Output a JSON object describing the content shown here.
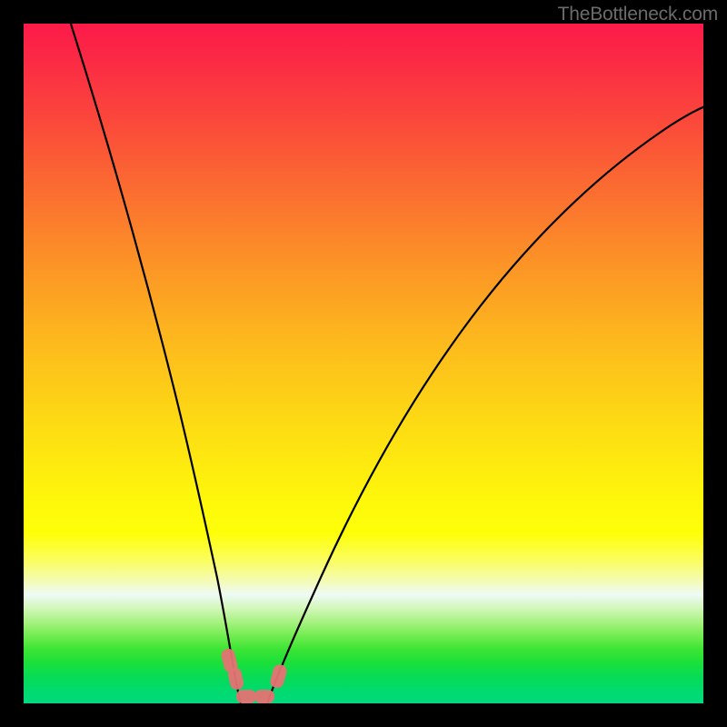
{
  "watermark": "TheBottleneck.com",
  "colors": {
    "gradient_top": "#fc1a49",
    "gradient_mid": "#fdde13",
    "gradient_bottom": "#00d97e",
    "curve": "#000000",
    "blob": "#e57373",
    "frame": "#000000"
  },
  "chart_data": {
    "type": "line",
    "title": "",
    "xlabel": "",
    "ylabel": "",
    "xlim": [
      0,
      100
    ],
    "ylim": [
      0,
      100
    ],
    "grid": false,
    "series": [
      {
        "name": "left-curve",
        "x": [
          7,
          10,
          13,
          16,
          19,
          22,
          25,
          27,
          28.5,
          29.5,
          30
        ],
        "y": [
          100,
          90,
          78,
          65,
          52,
          38,
          24,
          13,
          6,
          2,
          0
        ]
      },
      {
        "name": "right-curve",
        "x": [
          35,
          37,
          40,
          45,
          50,
          57,
          65,
          75,
          85,
          95,
          100
        ],
        "y": [
          0,
          4,
          11,
          23,
          34,
          46,
          57,
          68,
          77,
          84,
          87
        ]
      }
    ],
    "markers": [
      {
        "name": "left-blob-upper",
        "x": 29,
        "y": 5
      },
      {
        "name": "left-blob-mid",
        "x": 30,
        "y": 2
      },
      {
        "name": "bottom-blob-left",
        "x": 31,
        "y": 0
      },
      {
        "name": "bottom-blob-right",
        "x": 34,
        "y": 0
      },
      {
        "name": "right-blob",
        "x": 37,
        "y": 4
      }
    ]
  }
}
